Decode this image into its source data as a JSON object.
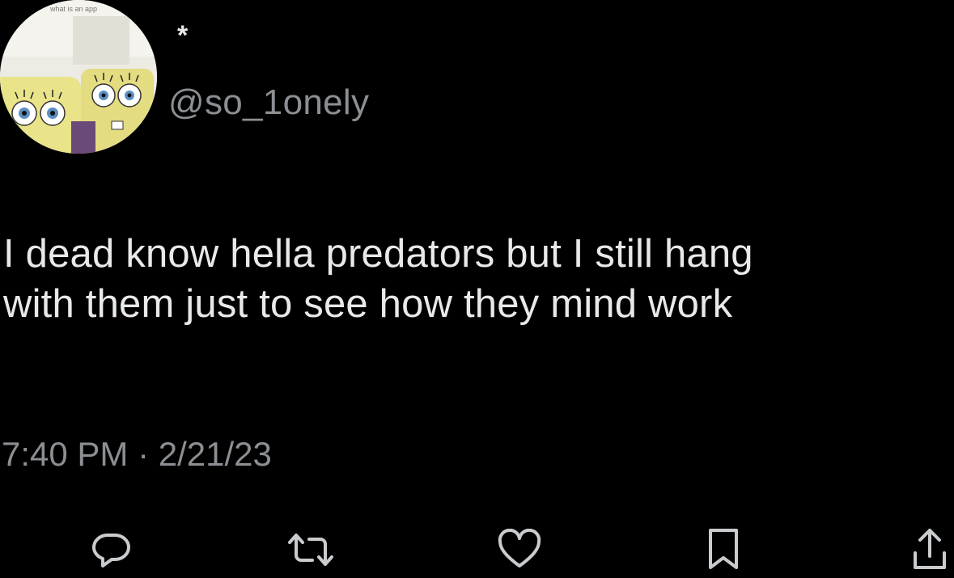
{
  "tweet": {
    "display_name": "*",
    "handle": "@so_1onely",
    "text": "I dead know hella predators but I still hang\nwith them just to see how they mind work",
    "time": "7:40 PM",
    "separator": "·",
    "date": "2/21/23",
    "avatar_caption": "what is an app"
  },
  "actions": [
    {
      "name": "reply",
      "icon": "reply-icon"
    },
    {
      "name": "retweet",
      "icon": "retweet-icon"
    },
    {
      "name": "like",
      "icon": "heart-icon"
    },
    {
      "name": "bookmark",
      "icon": "bookmark-icon"
    },
    {
      "name": "share",
      "icon": "share-icon"
    }
  ],
  "colors": {
    "background": "#000000",
    "text": "#e7e9ea",
    "secondary": "#8b8f93"
  }
}
